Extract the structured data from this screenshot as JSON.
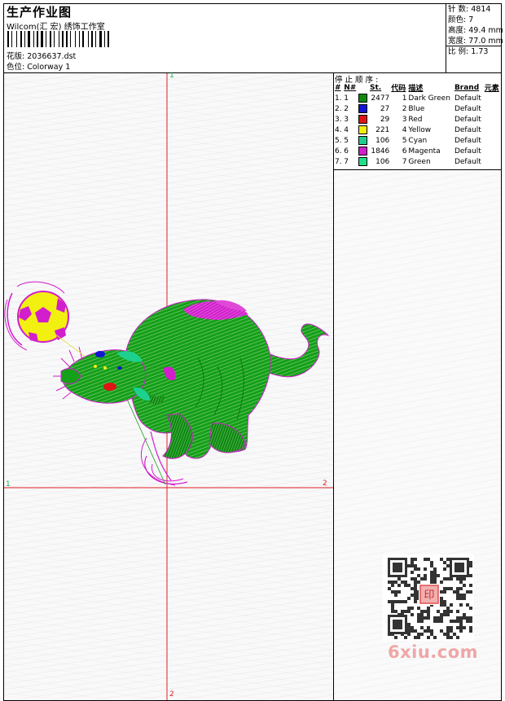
{
  "header": {
    "title": "生产作业图",
    "subtitle": "Wilcom(汇 宏) 绣饰工作室",
    "pattern_label": "花版:",
    "pattern_value": "2036637.dst",
    "colorway_label": "色位:",
    "colorway_value": "Colorway 1"
  },
  "stats": {
    "stitches_label": "针 数:",
    "stitches_value": "4814",
    "colors_label": "颜色:",
    "colors_value": "7",
    "height_label": "高度:",
    "height_value": "49.4 mm",
    "width_label": "宽度:",
    "width_value": "77.0 mm",
    "scale_label": "比 例:",
    "scale_value": "1.73"
  },
  "axes": {
    "top": "1",
    "left": "1",
    "right": "2",
    "bottom": "2"
  },
  "stop_sequence": {
    "title": "停 止 顺 序 :",
    "headers": [
      "#",
      "N#",
      "St.",
      "代码",
      "描述",
      "Brand",
      "元素"
    ],
    "rows": [
      {
        "idx": "1.",
        "n": "1",
        "color": "#0d8a10",
        "st": "2477",
        "code": "1",
        "desc": "Dark Green",
        "brand": "Default"
      },
      {
        "idx": "2.",
        "n": "2",
        "color": "#1414d2",
        "st": "27",
        "code": "2",
        "desc": "Blue",
        "brand": "Default"
      },
      {
        "idx": "3.",
        "n": "3",
        "color": "#e01414",
        "st": "29",
        "code": "3",
        "desc": "Red",
        "brand": "Default"
      },
      {
        "idx": "4.",
        "n": "4",
        "color": "#f2f010",
        "st": "221",
        "code": "4",
        "desc": "Yellow",
        "brand": "Default"
      },
      {
        "idx": "5.",
        "n": "5",
        "color": "#1ed08e",
        "st": "106",
        "code": "5",
        "desc": "Cyan",
        "brand": "Default"
      },
      {
        "idx": "6.",
        "n": "6",
        "color": "#d21ecc",
        "st": "1846",
        "code": "6",
        "desc": "Magenta",
        "brand": "Default"
      },
      {
        "idx": "7.",
        "n": "7",
        "color": "#1ee08a",
        "st": "106",
        "code": "7",
        "desc": "Green",
        "brand": "Default"
      }
    ]
  },
  "watermark": {
    "site": "6xiu.com",
    "seal": "印"
  },
  "colors": {
    "axis": "#e02020",
    "dark_green": "#0d8a10",
    "magenta": "#d21ecc",
    "yellow": "#f2f010",
    "cyan": "#1ed08e",
    "red": "#e01414",
    "blue": "#1414d2"
  }
}
